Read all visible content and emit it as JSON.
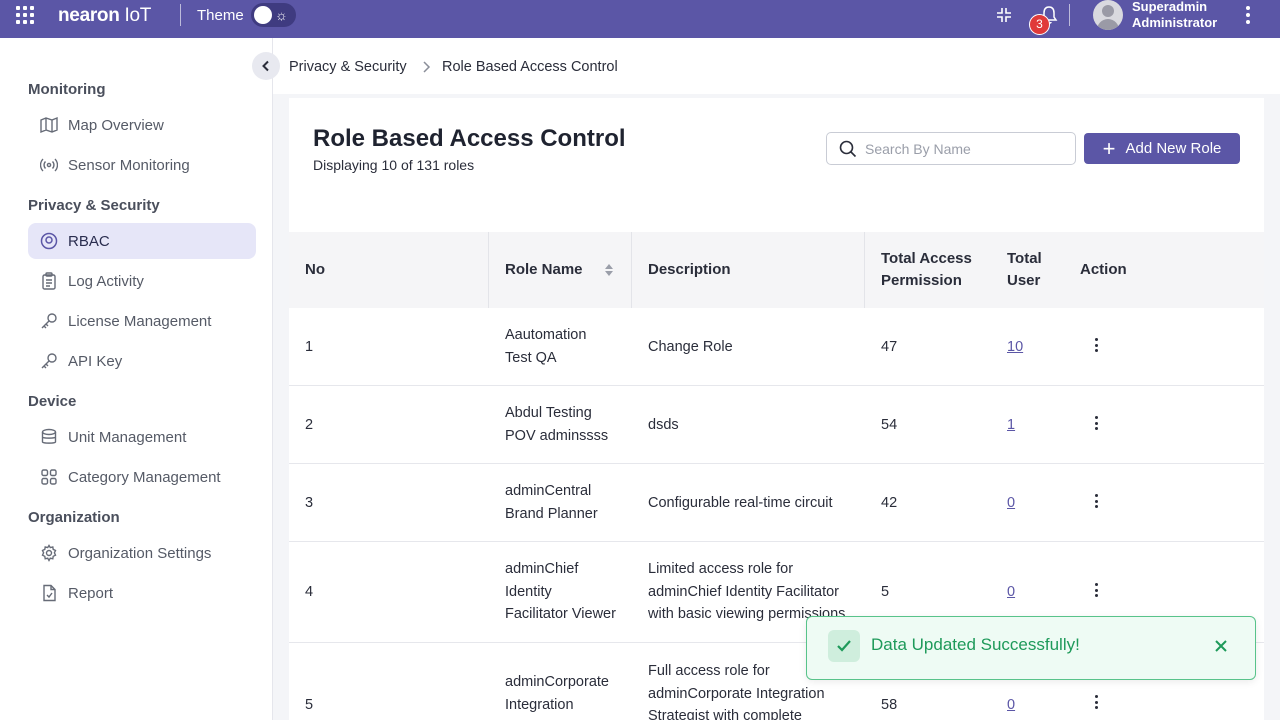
{
  "header": {
    "logo_brand": "nearon",
    "logo_suffix": " IoT",
    "theme_label": "Theme",
    "notification_count": "3",
    "user_name": "Superadmin",
    "user_role": "Administrator"
  },
  "sidebar": {
    "sections": [
      {
        "title": "Monitoring"
      },
      {
        "title": "Privacy & Security"
      },
      {
        "title": "Device"
      },
      {
        "title": "Organization"
      }
    ],
    "items": [
      {
        "label": "Map Overview",
        "icon": "map-icon"
      },
      {
        "label": "Sensor Monitoring",
        "icon": "broadcast-icon"
      },
      {
        "label": "RBAC",
        "icon": "user-circle-icon",
        "active": true
      },
      {
        "label": "Log Activity",
        "icon": "clipboard-icon"
      },
      {
        "label": "License Management",
        "icon": "key-icon"
      },
      {
        "label": "API Key",
        "icon": "key-icon"
      },
      {
        "label": "Unit Management",
        "icon": "database-icon"
      },
      {
        "label": "Category Management",
        "icon": "grid-icon"
      },
      {
        "label": "Organization Settings",
        "icon": "gear-icon"
      },
      {
        "label": "Report",
        "icon": "document-icon"
      }
    ]
  },
  "breadcrumb": {
    "parent": "Privacy & Security",
    "current": "Role Based Access Control"
  },
  "page": {
    "title": "Role Based Access Control",
    "subtitle": "Displaying 10 of 131 roles",
    "search_placeholder": "Search By Name",
    "add_button_label": "Add New Role"
  },
  "table": {
    "headers": {
      "no": "No",
      "role_name": "Role Name",
      "description": "Description",
      "total_access_1": "Total Access",
      "total_access_2": "Permission",
      "total_user_1": "Total",
      "total_user_2": "User",
      "action": "Action"
    },
    "rows": [
      {
        "no": "1",
        "role_name": [
          "Aautomation",
          "Test QA"
        ],
        "description": [
          "Change Role"
        ],
        "permissions": "47",
        "users": "10"
      },
      {
        "no": "2",
        "role_name": [
          "Abdul Testing",
          "POV adminssss"
        ],
        "description": [
          "dsds"
        ],
        "permissions": "54",
        "users": "1"
      },
      {
        "no": "3",
        "role_name": [
          "adminCentral",
          "Brand Planner"
        ],
        "description": [
          "Configurable real-time circuit"
        ],
        "permissions": "42",
        "users": "0"
      },
      {
        "no": "4",
        "role_name": [
          "adminChief",
          "Identity",
          "Facilitator Viewer"
        ],
        "description": [
          "Limited access role for",
          "adminChief Identity Facilitator",
          "with basic viewing permissions"
        ],
        "permissions": "5",
        "users": "0"
      },
      {
        "no": "5",
        "role_name": [
          "adminCorporate",
          "Integration"
        ],
        "description": [
          "Full access role for",
          "adminCorporate Integration",
          "Strategist with complete"
        ],
        "permissions": "58",
        "users": "0"
      }
    ]
  },
  "toast": {
    "message": "Data Updated Successfully!"
  }
}
